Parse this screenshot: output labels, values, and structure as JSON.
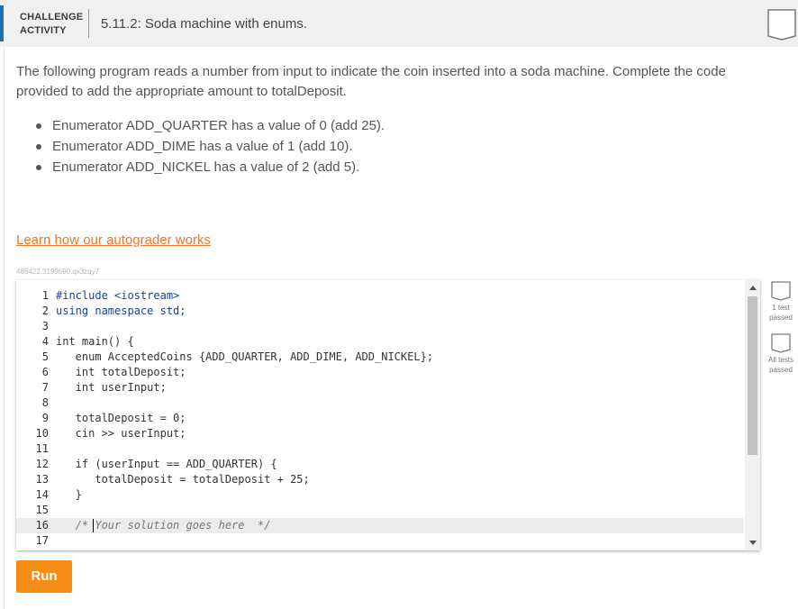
{
  "header": {
    "activity_type_line1": "CHALLENGE",
    "activity_type_line2": "ACTIVITY",
    "title": "5.11.2: Soda machine with enums.",
    "accent_color": "#1b6fb5",
    "bookmark_icon": "completion-bookmark-icon"
  },
  "description": {
    "text": "The following program reads a number from input to indicate the coin inserted into a soda machine. Complete the code provided to add the appropriate amount to totalDeposit.",
    "bullets": [
      "Enumerator ADD_QUARTER has a value of 0 (add 25).",
      "Enumerator ADD_DIME has a value of 1 (add 10).",
      "Enumerator ADD_NICKEL has a value of 2 (add 5)."
    ]
  },
  "links": {
    "autograder": "Learn how our autograder works",
    "link_color": "#e8792b"
  },
  "activity_id": "486422.3199690.qx3zqy7",
  "editor": {
    "active_line": 16,
    "lines": [
      {
        "number": "1",
        "text": "#include <iostream>",
        "kind": "include"
      },
      {
        "number": "2",
        "text": "using namespace std;",
        "kind": "using"
      },
      {
        "number": "3",
        "text": "",
        "kind": "plain"
      },
      {
        "number": "4",
        "text": "int main() {",
        "kind": "plain"
      },
      {
        "number": "5",
        "text": "   enum AcceptedCoins {ADD_QUARTER, ADD_DIME, ADD_NICKEL};",
        "kind": "plain"
      },
      {
        "number": "6",
        "text": "   int totalDeposit;",
        "kind": "plain"
      },
      {
        "number": "7",
        "text": "   int userInput;",
        "kind": "plain"
      },
      {
        "number": "8",
        "text": "",
        "kind": "plain"
      },
      {
        "number": "9",
        "text": "   totalDeposit = 0;",
        "kind": "plain"
      },
      {
        "number": "10",
        "text": "   cin >> userInput;",
        "kind": "plain"
      },
      {
        "number": "11",
        "text": "",
        "kind": "plain"
      },
      {
        "number": "12",
        "text": "   if (userInput == ADD_QUARTER) {",
        "kind": "plain"
      },
      {
        "number": "13",
        "text": "      totalDeposit = totalDeposit + 25;",
        "kind": "plain"
      },
      {
        "number": "14",
        "text": "   }",
        "kind": "plain"
      },
      {
        "number": "15",
        "text": "",
        "kind": "plain"
      },
      {
        "number": "16",
        "text": "   /* Your solution goes here  */",
        "kind": "comment"
      },
      {
        "number": "17",
        "text": "",
        "kind": "plain"
      }
    ]
  },
  "tests": [
    {
      "label": "1 test passed",
      "icon": "test-status-box-icon"
    },
    {
      "label": "All tests passed",
      "icon": "test-status-box-icon"
    }
  ],
  "run_button": {
    "label": "Run",
    "color": "#f48d13"
  }
}
